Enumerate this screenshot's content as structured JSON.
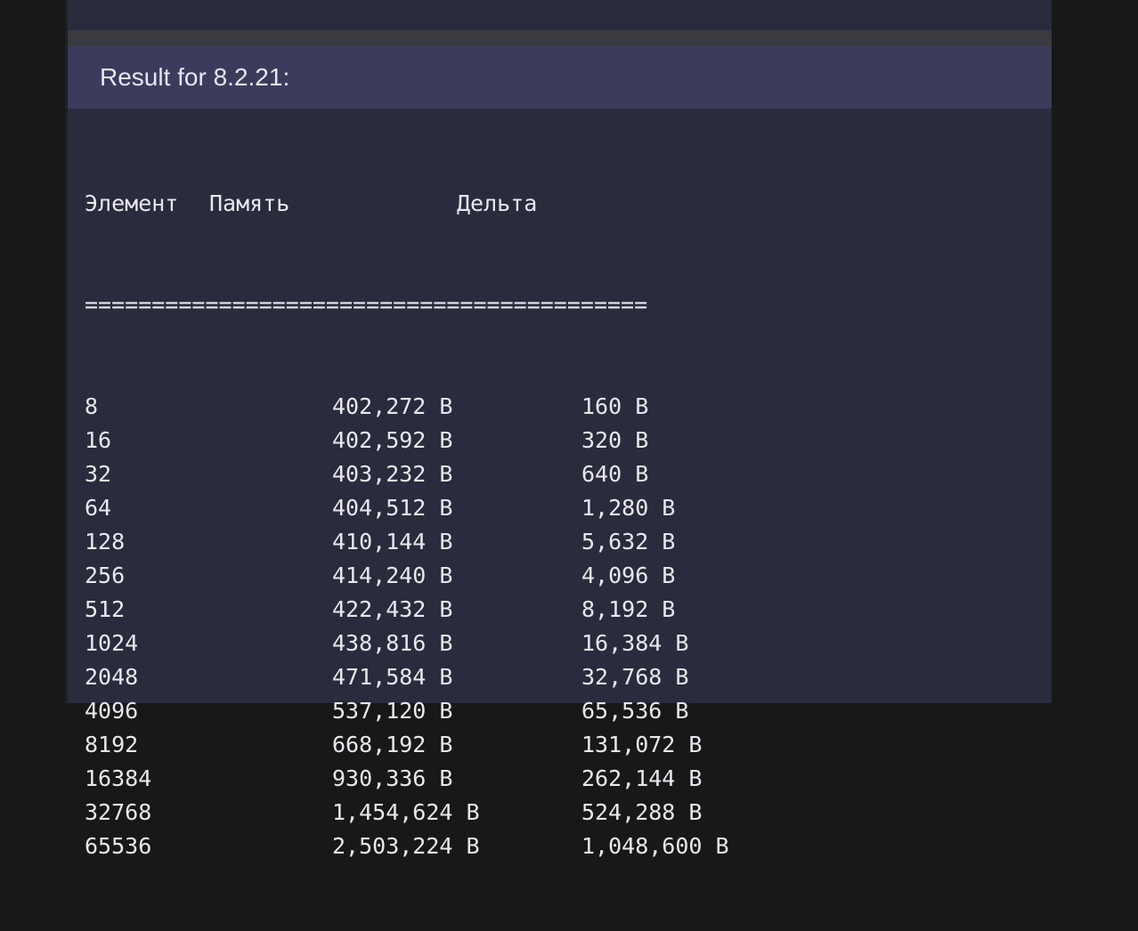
{
  "header": {
    "title": "Result for 8.2.21:"
  },
  "output": {
    "columns": [
      "Элемент",
      "Память",
      "Дельта"
    ],
    "separator": "==========================================",
    "rows": [
      {
        "element": "8",
        "memory": "402,272 B",
        "delta": "160 B"
      },
      {
        "element": "16",
        "memory": "402,592 B",
        "delta": "320 B"
      },
      {
        "element": "32",
        "memory": "403,232 B",
        "delta": "640 B"
      },
      {
        "element": "64",
        "memory": "404,512 B",
        "delta": "1,280 B"
      },
      {
        "element": "128",
        "memory": "410,144 B",
        "delta": "5,632 B"
      },
      {
        "element": "256",
        "memory": "414,240 B",
        "delta": "4,096 B"
      },
      {
        "element": "512",
        "memory": "422,432 B",
        "delta": "8,192 B"
      },
      {
        "element": "1024",
        "memory": "438,816 B",
        "delta": "16,384 B"
      },
      {
        "element": "2048",
        "memory": "471,584 B",
        "delta": "32,768 B"
      },
      {
        "element": "4096",
        "memory": "537,120 B",
        "delta": "65,536 B"
      },
      {
        "element": "8192",
        "memory": "668,192 B",
        "delta": "131,072 B"
      },
      {
        "element": "16384",
        "memory": "930,336 B",
        "delta": "262,144 B"
      },
      {
        "element": "32768",
        "memory": "1,454,624 B",
        "delta": "524,288 B"
      },
      {
        "element": "65536",
        "memory": "2,503,224 B",
        "delta": "1,048,600 B"
      }
    ]
  }
}
